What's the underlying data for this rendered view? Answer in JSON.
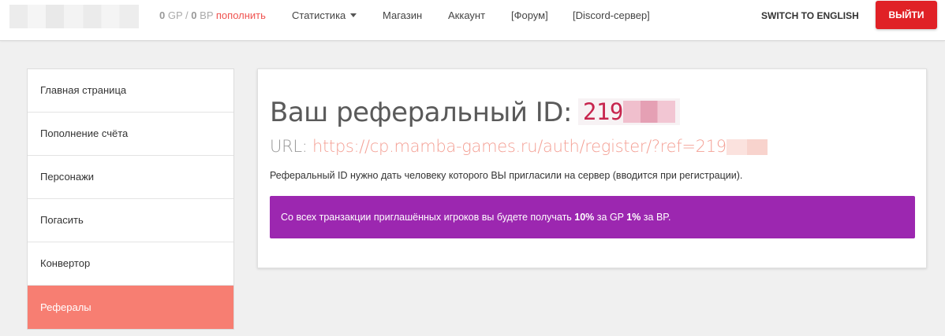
{
  "navbar": {
    "balance": {
      "gp_value": "0",
      "gp_unit": "GP",
      "separator": "/",
      "bp_value": "0",
      "bp_unit": "BP",
      "topup_label": "пополнить"
    },
    "links": [
      {
        "label": "Статистика",
        "has_dropdown": true
      },
      {
        "label": "Магазин"
      },
      {
        "label": "Аккаунт"
      },
      {
        "label": "[Форум]"
      },
      {
        "label": "[Discord-сервер]"
      }
    ],
    "switch_lang_label": "SWITCH TO ENGLISH",
    "logout_label": "ВЫЙТИ"
  },
  "sidebar": {
    "items": [
      {
        "label": "Главная страница",
        "active": false
      },
      {
        "label": "Пополнение счёта",
        "active": false
      },
      {
        "label": "Персонажи",
        "active": false
      },
      {
        "label": "Погасить",
        "active": false
      },
      {
        "label": "Конвертор",
        "active": false
      },
      {
        "label": "Рефералы",
        "active": true
      }
    ]
  },
  "main": {
    "title": "Ваш реферальный ID:",
    "ref_id_visible": "219",
    "url_label": "URL:",
    "url_visible": "https://cp.mamba-games.ru/auth/register/?ref=219",
    "description": "Реферальный ID нужно дать человеку которого ВЫ пригласили на сервер (вводится при регистрации).",
    "notice": {
      "text_before": "Со всех транзакции приглашённых игроков вы будете получать ",
      "percent_1": "10%",
      "text_middle": " за GP ",
      "percent_2": "1%",
      "text_after": " за BP."
    }
  },
  "colors": {
    "accent_red": "#e02126",
    "topup_link": "#ef5350",
    "sidebar_active": "#f77e72",
    "ref_id_text": "#c7254e",
    "url_link": "#f4a196",
    "notice_bg": "#9c27b0"
  }
}
